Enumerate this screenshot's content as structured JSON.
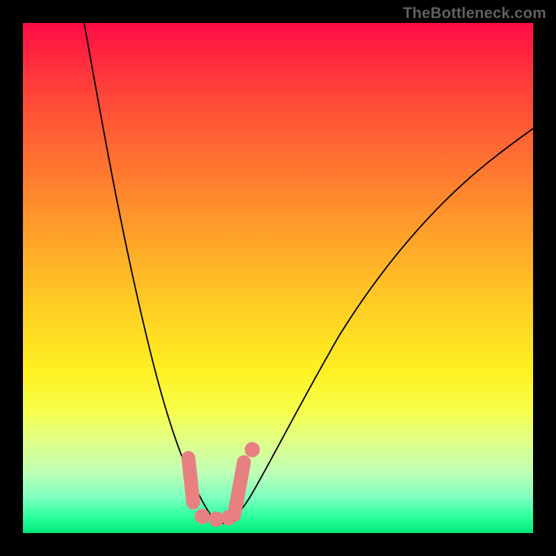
{
  "watermark": "TheBottleneck.com",
  "chart_data": {
    "type": "line",
    "title": "",
    "xlabel": "",
    "ylabel": "",
    "xlim": [
      0,
      100
    ],
    "ylim": [
      0,
      100
    ],
    "grid": false,
    "legend": false,
    "series": [
      {
        "name": "left-curve",
        "x": [
          12,
          14,
          16,
          18,
          20,
          22,
          24,
          26,
          28,
          30,
          32,
          34,
          36,
          37
        ],
        "y": [
          100,
          89,
          78,
          67,
          57,
          47,
          38,
          30,
          23,
          17,
          12,
          8,
          5,
          3
        ]
      },
      {
        "name": "right-curve",
        "x": [
          38,
          40,
          42,
          45,
          48,
          52,
          56,
          60,
          65,
          70,
          76,
          82,
          88,
          94,
          100
        ],
        "y": [
          3,
          5,
          8,
          12,
          17,
          24,
          32,
          40,
          48,
          55,
          62,
          68,
          73,
          77,
          80
        ]
      }
    ],
    "markers": [
      {
        "name": "left-rod",
        "x": 32.5,
        "y_top": 15,
        "y_bottom": 6
      },
      {
        "name": "right-rod",
        "x": 42.0,
        "y_top": 14,
        "y_bottom": 4
      },
      {
        "name": "dot-upper",
        "x": 43.5,
        "y": 16
      },
      {
        "name": "dot-a",
        "x": 35.0,
        "y": 3.5
      },
      {
        "name": "dot-b",
        "x": 37.5,
        "y": 3.0
      },
      {
        "name": "dot-c",
        "x": 40.0,
        "y": 3.5
      }
    ],
    "background_gradient": {
      "top": "#ff0b45",
      "mid": "#ffd326",
      "bottom": "#00e879"
    }
  }
}
